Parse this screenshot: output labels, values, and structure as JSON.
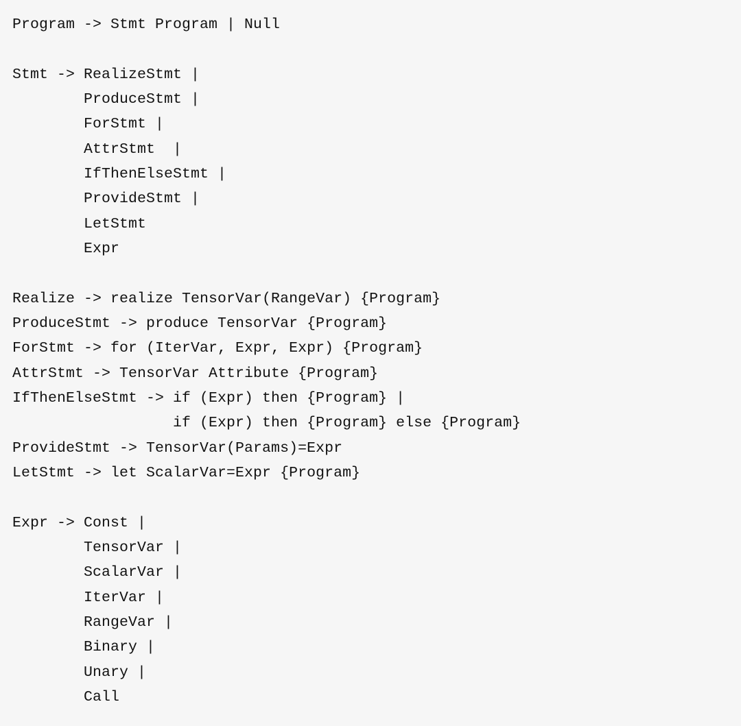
{
  "grammar_lines": [
    "Program -> Stmt Program | Null",
    "",
    "Stmt -> RealizeStmt |",
    "        ProduceStmt |",
    "        ForStmt |",
    "        AttrStmt  |",
    "        IfThenElseStmt |",
    "        ProvideStmt |",
    "        LetStmt",
    "        Expr",
    "",
    "Realize -> realize TensorVar(RangeVar) {Program}",
    "ProduceStmt -> produce TensorVar {Program}",
    "ForStmt -> for (IterVar, Expr, Expr) {Program}",
    "AttrStmt -> TensorVar Attribute {Program}",
    "IfThenElseStmt -> if (Expr) then {Program} |",
    "                  if (Expr) then {Program} else {Program}",
    "ProvideStmt -> TensorVar(Params)=Expr",
    "LetStmt -> let ScalarVar=Expr {Program}",
    "",
    "Expr -> Const |",
    "        TensorVar |",
    "        ScalarVar |",
    "        IterVar |",
    "        RangeVar |",
    "        Binary |",
    "        Unary |",
    "        Call"
  ]
}
